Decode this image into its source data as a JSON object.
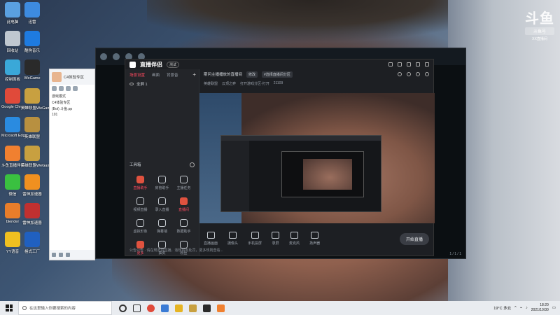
{
  "desktop": {
    "icons": [
      {
        "label": "此电脑",
        "color": "#5aa0e0"
      },
      {
        "label": "迅雷",
        "color": "#3d8be0"
      },
      {
        "label": "回收站",
        "color": "#c0c8d0"
      },
      {
        "label": "酷狗音乐",
        "color": "#1e7be0"
      },
      {
        "label": "控制面板",
        "color": "#3aa8d8"
      },
      {
        "label": "WeGame",
        "color": "#2a2a2a"
      },
      {
        "label": "Google Chrome",
        "color": "#e04a3a"
      },
      {
        "label": "英雄联盟WeGame版",
        "color": "#c8a040"
      },
      {
        "label": "Microsoft Edge",
        "color": "#2a8be0"
      },
      {
        "label": "英雄联盟",
        "color": "#b89040"
      },
      {
        "label": "斗鱼直播伴侣",
        "color": "#f08030"
      },
      {
        "label": "英雄联盟WeGame版",
        "color": "#c8a040"
      },
      {
        "label": "微信",
        "color": "#3ac040"
      },
      {
        "label": "雷神加速器",
        "color": "#f09020"
      },
      {
        "label": "blender",
        "color": "#e87d2a"
      },
      {
        "label": "雷神加速器",
        "color": "#c03030"
      },
      {
        "label": "YY语音",
        "color": "#f0c020"
      },
      {
        "label": "格式工厂",
        "color": "#2060c0"
      }
    ]
  },
  "watermark": {
    "logo": "斗鱼",
    "tag": "斗鱼号",
    "id": "XX直播间"
  },
  "game_window": {
    "counter": "1 / 1 / 1"
  },
  "qq_window": {
    "title": "C4体验专区",
    "lines": [
      "游戏模式",
      "C4体验专区",
      "(Bot) 斗鱼.pp",
      "101"
    ]
  },
  "live_window": {
    "app_title": "直播伴侣",
    "version": "测试",
    "side_tabs": [
      "场景设置",
      "画面",
      "背景音"
    ],
    "scene_name": "全屏 1",
    "tools_header": "工具箱",
    "tools": [
      {
        "label": "直播助手",
        "red": true
      },
      {
        "label": "房管助手",
        "red": false
      },
      {
        "label": "主播任务",
        "red": false
      },
      {
        "label": "视频直播",
        "red": false
      },
      {
        "label": "录入直播",
        "red": false
      },
      {
        "label": "直播间",
        "red": true
      },
      {
        "label": "虚拟形象",
        "red": false
      },
      {
        "label": "弹幕墙",
        "red": false
      },
      {
        "label": "数据助手",
        "red": false
      },
      {
        "label": "更多",
        "red": true
      },
      {
        "label": "抽奖",
        "red": false
      },
      {
        "label": "粉丝",
        "red": false
      }
    ],
    "room_title": "斯问主播播放的直播间",
    "room_chip1": "修改",
    "room_chip2": "#选择直播间分区",
    "tags": [
      "英雄联盟",
      "云顶之弈",
      "打开游戏分区·打开",
      "21109"
    ],
    "controls": [
      {
        "label": "直播画面"
      },
      {
        "label": "摄像头"
      },
      {
        "label": "手机投屏"
      },
      {
        "label": "录屏"
      },
      {
        "label": "麦克风"
      },
      {
        "label": "扬声器"
      }
    ],
    "go_live_label": "开始直播",
    "notice": "公告公告 · 请在规范内直播，违规将有处罚，更多规则查看..."
  },
  "taskbar": {
    "search_placeholder": "在这里输入你要搜索的内容",
    "weather": "19°C 多云",
    "time": "18:20",
    "date": "2021/10/30"
  }
}
